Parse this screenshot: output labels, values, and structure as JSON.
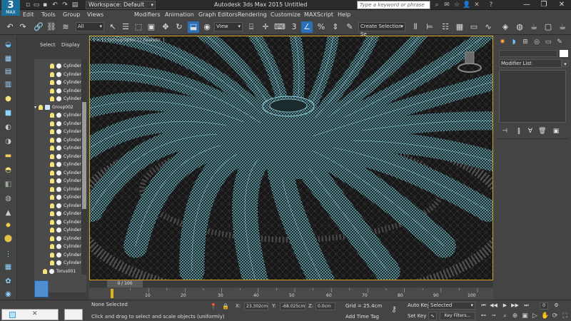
{
  "titlebar": {
    "app_logo": "MAX",
    "workspace_label": "Workspace: Default",
    "title": "Autodesk 3ds Max  2015    Untitled",
    "search_placeholder": "Type a keyword or phrase"
  },
  "menus": [
    "Edit",
    "Tools",
    "Group",
    "Views",
    "Modifiers",
    "Animation",
    "Graph Editors",
    "Rendering",
    "Customize",
    "MAXScript",
    "Help"
  ],
  "toolbar": {
    "selection_filter": "All",
    "ref_coord": "View",
    "selection_set": "Create Selection Se",
    "snap_label": "3"
  },
  "explorer": {
    "tabs": [
      "Select",
      "Display"
    ],
    "rows": [
      {
        "label": "Cylinder",
        "type": "child"
      },
      {
        "label": "Cylinder",
        "type": "child"
      },
      {
        "label": "Cylinder",
        "type": "child"
      },
      {
        "label": "Cylinder",
        "type": "child"
      },
      {
        "label": "Cylinder",
        "type": "child"
      },
      {
        "label": "Group002",
        "type": "group"
      },
      {
        "label": "Cylinder",
        "type": "child"
      },
      {
        "label": "Cylinder",
        "type": "child"
      },
      {
        "label": "Cylinder",
        "type": "child"
      },
      {
        "label": "Cylinder",
        "type": "child"
      },
      {
        "label": "Cylinder",
        "type": "child"
      },
      {
        "label": "Cylinder",
        "type": "child"
      },
      {
        "label": "Cylinder",
        "type": "child"
      },
      {
        "label": "Cylinder",
        "type": "child"
      },
      {
        "label": "Cylinder",
        "type": "child"
      },
      {
        "label": "Cylinder",
        "type": "child"
      },
      {
        "label": "Cylinder",
        "type": "child"
      },
      {
        "label": "Cylinder",
        "type": "child"
      },
      {
        "label": "Cylinder",
        "type": "child"
      },
      {
        "label": "Cylinder",
        "type": "child"
      },
      {
        "label": "Cylinder",
        "type": "child"
      },
      {
        "label": "Cylinder",
        "type": "child"
      },
      {
        "label": "Cylinder",
        "type": "child"
      },
      {
        "label": "Cylinder",
        "type": "child"
      },
      {
        "label": "Cylinder",
        "type": "child"
      },
      {
        "label": "Torus001",
        "type": "root"
      }
    ]
  },
  "viewport": {
    "label": "[ + ] [ Orthographic ] [ Realistic ]",
    "wire_color": "#8fd3e0",
    "border_color": "#d6a020"
  },
  "command_panel": {
    "modifier_list": "Modifier List"
  },
  "timeline": {
    "frame_display": "0 / 100",
    "ticks": [
      "10",
      "20",
      "30",
      "40",
      "50",
      "60",
      "70",
      "80",
      "90",
      "100"
    ]
  },
  "status": {
    "selection": "None Selected",
    "prompt": "Click and drag to select and scale objects (uniformly)",
    "x_label": "X:",
    "x_value": "23.302cm",
    "y_label": "Y:",
    "y_value": "-68.025cm",
    "z_label": "Z:",
    "z_value": "0.0cm",
    "grid": "Grid = 25.4cm",
    "add_time_tag": "Add Time Tag",
    "auto_key": "Auto Key",
    "set_key": "Set Key",
    "selected_set": "Selected",
    "key_filters": "Key Filters...",
    "frame": "0"
  }
}
